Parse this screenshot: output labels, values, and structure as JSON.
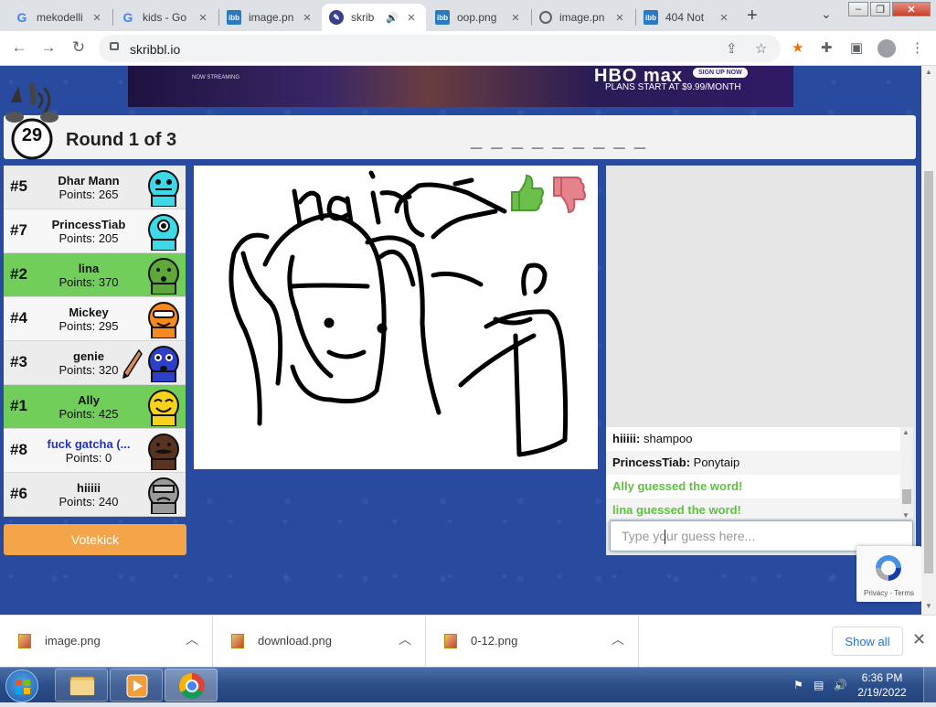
{
  "browser": {
    "tabs": [
      {
        "title": "mekodelli",
        "icon": "google-icon"
      },
      {
        "title": "kids - Go",
        "icon": "google-icon"
      },
      {
        "title": "image.pn",
        "icon": "ibb-icon"
      },
      {
        "title": "skrib",
        "icon": "skribbl-icon",
        "active": true,
        "audio": true
      },
      {
        "title": "oop.png",
        "icon": "ibb-icon"
      },
      {
        "title": "image.pn",
        "icon": "globe-icon"
      },
      {
        "title": "404 Not",
        "icon": "ibb-icon"
      }
    ],
    "url": "skribbl.io"
  },
  "ad": {
    "brand": "HBO max",
    "cta": "SIGN UP NOW",
    "offer": "PLANS START AT $9.99/MONTH",
    "streaming": "NOW STREAMING"
  },
  "game": {
    "timer": "29",
    "round": "Round 1 of 3",
    "word_hint": "_ _ _ _ _ _ _ _ _"
  },
  "players": [
    {
      "rank": "#5",
      "name": "Dhar Mann",
      "points": "Points: 265",
      "avatar_color": "#3fd8e6",
      "state": "normal"
    },
    {
      "rank": "#7",
      "name": "PrincessTiab",
      "points": "Points: 205",
      "avatar_color": "#3fd8e6",
      "state": "alt"
    },
    {
      "rank": "#2",
      "name": "lina",
      "points": "Points: 370",
      "avatar_color": "#5ea83b",
      "state": "guessed"
    },
    {
      "rank": "#4",
      "name": "Mickey",
      "points": "Points: 295",
      "avatar_color": "#f58a1f",
      "state": "alt"
    },
    {
      "rank": "#3",
      "name": "genie",
      "points": "Points: 320",
      "avatar_color": "#2d3fc8",
      "state": "normal",
      "drawing": true
    },
    {
      "rank": "#1",
      "name": "Ally",
      "points": "Points: 425",
      "avatar_color": "#f7d21b",
      "state": "guessed"
    },
    {
      "rank": "#8",
      "name": "fuck gatcha (...",
      "points": "Points: 0",
      "avatar_color": "#5a3320",
      "state": "alt",
      "self": true
    },
    {
      "rank": "#6",
      "name": "hiiiii",
      "points": "Points: 240",
      "avatar_color": "#9a9a9a",
      "state": "normal"
    }
  ],
  "votekick_label": "Votekick",
  "chat": {
    "messages": [
      {
        "author": "hiiiii:",
        "text": "shampoo",
        "type": "normal"
      },
      {
        "author": "PrincessTiab:",
        "text": "Ponytaip",
        "type": "normal"
      },
      {
        "author": "",
        "text": "Ally guessed the word!",
        "type": "green"
      },
      {
        "author": "",
        "text": "lina guessed the word!",
        "type": "green"
      }
    ],
    "placeholder": "Type your guess here..."
  },
  "recaptcha": {
    "links": "Privacy - Terms"
  },
  "downloads": {
    "items": [
      "image.png",
      "download.png",
      "0-12.png"
    ],
    "show_all": "Show all"
  },
  "taskbar": {
    "time": "6:36 PM",
    "date": "2/19/2022"
  }
}
